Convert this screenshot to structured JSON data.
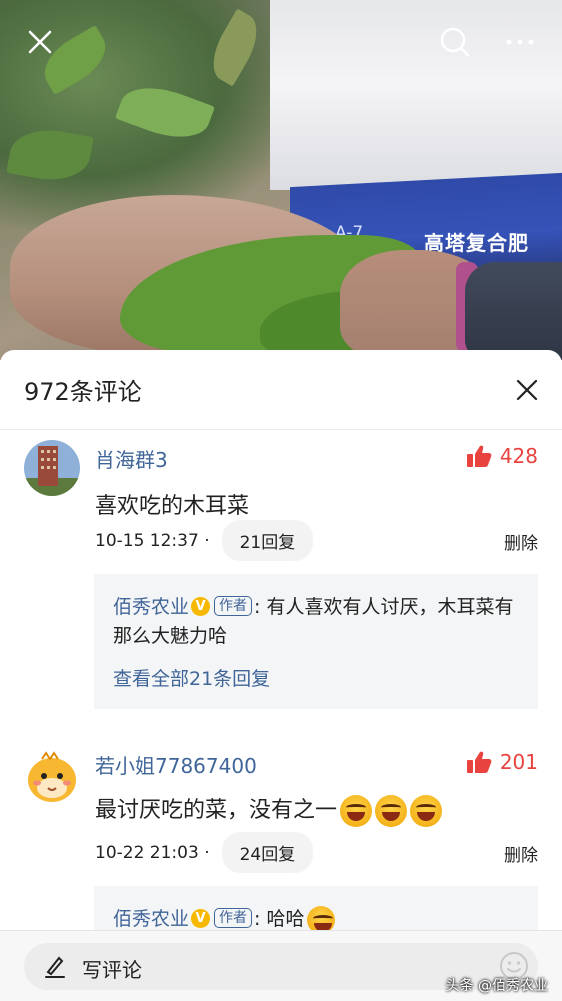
{
  "header": {
    "close_icon": "close-icon",
    "search_icon": "search-icon",
    "more_icon": "more-icon",
    "photo_bag_code": "A-7",
    "photo_bag_text": "高塔复合肥"
  },
  "comments_panel": {
    "title": "972条评论",
    "close_icon": "close-icon",
    "comments": [
      {
        "username": "肖海群3",
        "likes": "428",
        "text": "喜欢吃的木耳菜",
        "time": "10-15 12:37 ·",
        "reply_count": "21回复",
        "delete_label": "删除",
        "reply": {
          "author": "佰秀农业",
          "verified_badge": "V",
          "author_tag": "作者",
          "text": ": 有人喜欢有人讨厌，木耳菜有那么大魅力哈",
          "view_all": "查看全部21条回复"
        }
      },
      {
        "username": "若小姐77867400",
        "likes": "201",
        "text": "最讨厌吃的菜，没有之一",
        "emoji_icon": "laughing-emoji-icon",
        "time": "10-22 21:03 ·",
        "reply_count": "24回复",
        "delete_label": "删除",
        "reply": {
          "author": "佰秀农业",
          "verified_badge": "V",
          "author_tag": "作者",
          "text": ": 哈哈"
        }
      }
    ]
  },
  "bottom_bar": {
    "write_label": "写评论",
    "pen_icon": "pen-icon",
    "emoji_icon": "smiley-icon",
    "watermark": "头条 @佰秀农业"
  },
  "colors": {
    "link_blue": "#406599",
    "like_red": "#e8433f",
    "verified_yellow": "#f6b800"
  }
}
